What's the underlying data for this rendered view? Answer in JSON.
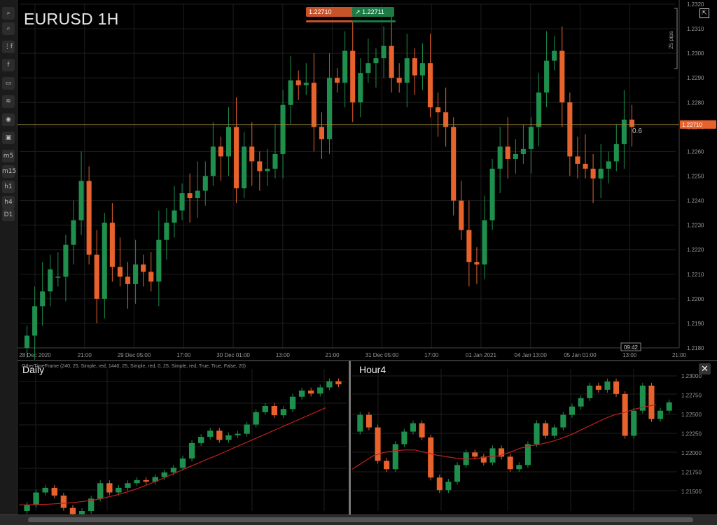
{
  "toolbar": {
    "items": [
      {
        "name": "zoom-in-icon",
        "glyph": "⌕"
      },
      {
        "name": "zoom-out-icon",
        "glyph": "⌕"
      },
      {
        "name": "indicators-icon",
        "glyph": "⋮f"
      },
      {
        "name": "share-icon",
        "glyph": "f"
      },
      {
        "name": "chat-icon",
        "glyph": "▭"
      },
      {
        "name": "layers-icon",
        "glyph": "≋"
      },
      {
        "name": "visibility-icon",
        "glyph": "◉"
      },
      {
        "name": "screenshot-icon",
        "glyph": "▣"
      },
      {
        "name": "timeframe-m5",
        "glyph": "m5"
      },
      {
        "name": "timeframe-m15",
        "glyph": "m15"
      },
      {
        "name": "timeframe-h1",
        "glyph": "h1"
      },
      {
        "name": "timeframe-h4",
        "glyph": "h4"
      },
      {
        "name": "timeframe-d1",
        "glyph": "D1"
      }
    ]
  },
  "header": {
    "symbol_title": "EURUSD 1H",
    "sell_price": "1.22710",
    "sell_arrow": "↘",
    "buy_price": "1.22711",
    "buy_arrow": "↗",
    "detach_icon": "⇱"
  },
  "colors": {
    "bull": "#1f8f4e",
    "bear": "#e8622d",
    "grid": "#1e1e1e",
    "price_line": "#a58a3e",
    "price_tag": "#e8622d",
    "ma": "#c0201f"
  },
  "chart_data": [
    {
      "type": "candlestick",
      "title": "EURUSD 1H",
      "ylim": [
        1.218,
        1.232
      ],
      "y_ticks": [
        "1.2320",
        "1.2310",
        "1.2300",
        "1.2290",
        "1.2280",
        "1.2270",
        "1.2260",
        "1.2250",
        "1.2240",
        "1.2230",
        "1.2220",
        "1.2210",
        "1.2200",
        "1.2190",
        "1.2180"
      ],
      "x_ticks": [
        "28 Dec 2020",
        "21:00",
        "29 Dec 05:00",
        "17:00",
        "30 Dec 01:00",
        "13:00",
        "21:00",
        "31 Dec 05:00",
        "17:00",
        "01 Jan 2021",
        "04 Jan 13:00",
        "05 Jan 01:00",
        "13:00",
        "21:00"
      ],
      "current_price": "1.22710",
      "current_price_value": 1.2271,
      "ruler_label": "25 pips",
      "cursor_label": "0.6",
      "time_label": "09:42",
      "closes": [
        1.2185,
        1.2197,
        1.2203,
        1.2212,
        1.2209,
        1.2222,
        1.2232,
        1.2248,
        1.2218,
        1.22,
        1.2231,
        1.2213,
        1.2209,
        1.2206,
        1.2214,
        1.2211,
        1.2207,
        1.2224,
        1.2231,
        1.2236,
        1.2243,
        1.2241,
        1.2244,
        1.225,
        1.2262,
        1.2258,
        1.227,
        1.2245,
        1.2262,
        1.2256,
        1.2252,
        1.2253,
        1.2259,
        1.2279,
        1.2289,
        1.2287,
        1.2288,
        1.227,
        1.2265,
        1.229,
        1.2288,
        1.2301,
        1.228,
        1.2292,
        1.2296,
        1.2298,
        1.2303,
        1.229,
        1.2288,
        1.2298,
        1.2291,
        1.2296,
        1.2278,
        1.2276,
        1.227,
        1.224,
        1.2228,
        1.2215,
        1.2214,
        1.2232,
        1.2253,
        1.2262,
        1.2257,
        1.2259,
        1.2261,
        1.227,
        1.2284,
        1.2297,
        1.2301,
        1.228,
        1.2258,
        1.2255,
        1.2253,
        1.2249,
        1.2253,
        1.2256,
        1.2263,
        1.2273,
        1.227
      ],
      "opens": [
        1.218,
        1.2185,
        1.2197,
        1.2203,
        1.2209,
        1.2209,
        1.2222,
        1.2232,
        1.2248,
        1.2218,
        1.22,
        1.2231,
        1.2213,
        1.2209,
        1.2206,
        1.2214,
        1.2211,
        1.2207,
        1.2224,
        1.2231,
        1.2236,
        1.2243,
        1.2241,
        1.2244,
        1.225,
        1.2262,
        1.2258,
        1.227,
        1.2245,
        1.2262,
        1.2256,
        1.2252,
        1.2253,
        1.2259,
        1.2279,
        1.2289,
        1.2287,
        1.2288,
        1.227,
        1.2265,
        1.229,
        1.2288,
        1.2301,
        1.228,
        1.2292,
        1.2296,
        1.2298,
        1.2303,
        1.229,
        1.2288,
        1.2298,
        1.2291,
        1.2296,
        1.2278,
        1.2276,
        1.227,
        1.224,
        1.2228,
        1.2215,
        1.2214,
        1.2232,
        1.2253,
        1.2262,
        1.2257,
        1.2259,
        1.2261,
        1.227,
        1.2284,
        1.2297,
        1.2301,
        1.228,
        1.2258,
        1.2255,
        1.2253,
        1.2249,
        1.2253,
        1.2256,
        1.2263,
        1.2273
      ]
    },
    {
      "type": "candlestick",
      "title": "Daily",
      "indicator_label": "OtherTimeFrame (240, 25, Simple, red, 1440, 25, Simple, red, 0, 25, Simple, red, True, True, False, 20)",
      "ylim": [
        1.186,
        1.232
      ],
      "closes": [
        1.188,
        1.192,
        1.1935,
        1.191,
        1.187,
        1.185,
        1.186,
        1.19,
        1.195,
        1.192,
        1.1935,
        1.195,
        1.196,
        1.1955,
        1.197,
        1.1985,
        1.2,
        1.203,
        1.208,
        1.21,
        1.212,
        1.209,
        1.2105,
        1.211,
        1.214,
        1.218,
        1.22,
        1.217,
        1.219,
        1.223,
        1.225,
        1.224,
        1.226,
        1.228,
        1.227
      ],
      "ma": [
        1.188,
        1.188,
        1.1881,
        1.1882,
        1.1884,
        1.1886,
        1.1889,
        1.1893,
        1.1898,
        1.1905,
        1.1913,
        1.1922,
        1.1933,
        1.1945,
        1.1958,
        1.1972,
        1.1986,
        1.2,
        1.2013,
        1.2027,
        1.204,
        1.2054,
        1.2068,
        1.2082,
        1.2096,
        1.211,
        1.2124,
        1.2138,
        1.2152,
        1.2166,
        1.218,
        1.2194
      ]
    },
    {
      "type": "candlestick",
      "title": "Hour4",
      "ylim": [
        1.214,
        1.231
      ],
      "y_ticks": [
        "1.23000",
        "1.22750",
        "1.22500",
        "1.22250",
        "1.22000",
        "1.21750",
        "1.21500"
      ],
      "closes": [
        1.2255,
        1.224,
        1.22,
        1.219,
        1.222,
        1.2235,
        1.2245,
        1.2228,
        1.218,
        1.2165,
        1.2175,
        1.2195,
        1.221,
        1.2205,
        1.2198,
        1.2215,
        1.2205,
        1.219,
        1.2195,
        1.222,
        1.2245,
        1.223,
        1.224,
        1.2255,
        1.2265,
        1.2275,
        1.229,
        1.2285,
        1.2295,
        1.228,
        1.223,
        1.226,
        1.229,
        1.225,
        1.226,
        1.227
      ],
      "ma": [
        1.219,
        1.2198,
        1.2206,
        1.221,
        1.2212,
        1.2213,
        1.2213,
        1.221,
        1.2207,
        1.2205,
        1.2203,
        1.2202,
        1.2203,
        1.2205,
        1.2206,
        1.221,
        1.2215,
        1.2218,
        1.222,
        1.2223,
        1.2227,
        1.2232,
        1.2238,
        1.2244,
        1.225,
        1.2255,
        1.2258,
        1.2262,
        1.2265,
        1.2267
      ]
    }
  ],
  "subcharts": {
    "daily_title": "Daily",
    "hour4_title": "Hour4",
    "close_icon": "✕"
  }
}
